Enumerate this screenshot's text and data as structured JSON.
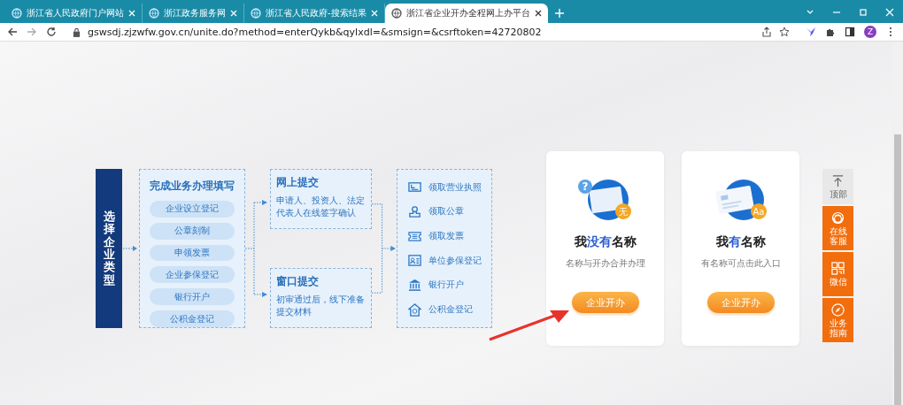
{
  "browser": {
    "tabs": [
      {
        "title": "浙江省人民政府门户网站",
        "selected": false
      },
      {
        "title": "浙江政务服务网",
        "selected": false
      },
      {
        "title": "浙江省人民政府-搜索结果",
        "selected": false
      },
      {
        "title": "浙江省企业开办全程网上办平台",
        "selected": true
      }
    ],
    "url": "gswsdj.zjzwfw.gov.cn/unite.do?method=enterQykb&qylxdl=&smsign=&csrftoken=42720802",
    "profile_initial": "Z"
  },
  "flow": {
    "start": "选择企业类型",
    "fill": {
      "title": "完成业务办理填写",
      "items": [
        "企业设立登记",
        "公章刻制",
        "申领发票",
        "企业参保登记",
        "银行开户",
        "公积金登记"
      ]
    },
    "submit": [
      {
        "title": "网上提交",
        "text": "申请人、投资人、法定代表人在线签字确认"
      },
      {
        "title": "窗口提交",
        "text": "初审通过后，线下准备提交材料"
      }
    ],
    "collect": [
      {
        "kind": "license",
        "label": "领取营业执照"
      },
      {
        "kind": "seal",
        "label": "领取公章"
      },
      {
        "kind": "invoice",
        "label": "领取发票"
      },
      {
        "kind": "card",
        "label": "单位参保登记"
      },
      {
        "kind": "bank",
        "label": "银行开户"
      },
      {
        "kind": "house",
        "label": "公积金登记"
      }
    ]
  },
  "cards": [
    {
      "kind": "no-name",
      "question_mark": "?",
      "title_before": "我",
      "title_highlight": "没有",
      "title_after": "名称",
      "subtitle": "名称与开办合并办理",
      "badge": "无",
      "button": "企业开办"
    },
    {
      "kind": "has-name",
      "title_before": "我",
      "title_highlight": "有",
      "title_after": "名称",
      "subtitle": "有名称可点击此入口",
      "badge": "Aa",
      "button": "企业开办"
    }
  ],
  "side_toolbar": [
    {
      "kind": "top",
      "label": "顶部"
    },
    {
      "kind": "service",
      "label": "在线客服"
    },
    {
      "kind": "wechat",
      "label": "微信"
    },
    {
      "kind": "guide",
      "label": "业务指南"
    }
  ]
}
